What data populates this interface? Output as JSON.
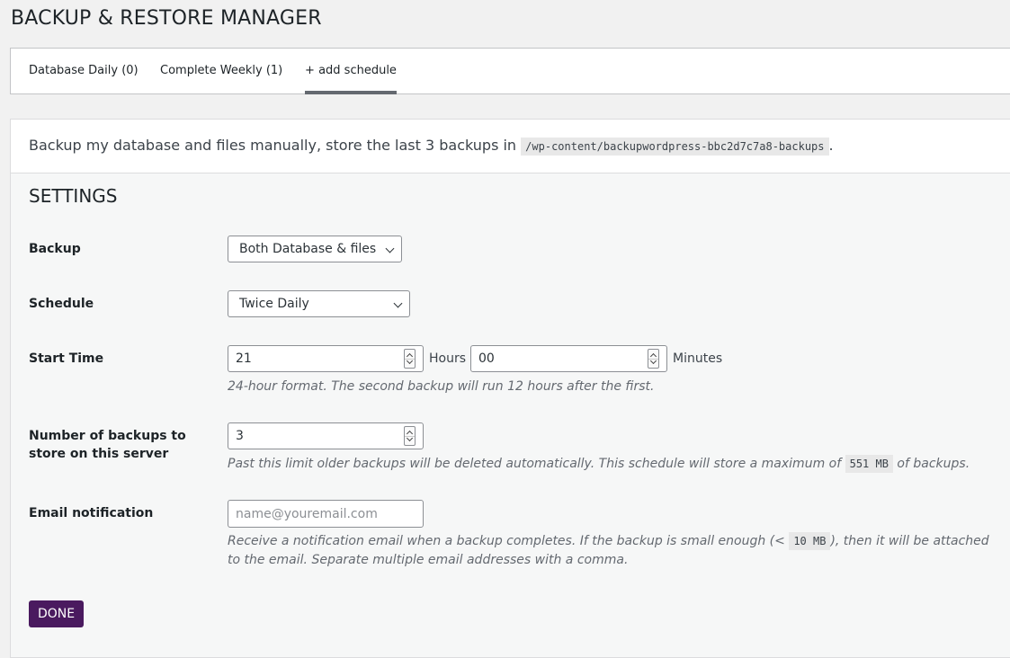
{
  "page": {
    "title": "BACKUP & RESTORE MANAGER"
  },
  "tabs": [
    {
      "label": "Database Daily (0)"
    },
    {
      "label": "Complete Weekly (1)"
    },
    {
      "label": "+ add schedule"
    }
  ],
  "intro": {
    "text": "Backup my database and files manually, store the last 3 backups in",
    "path": "/wp-content/backupwordpress-bbc2d7c7a8-backups",
    "suffix": "."
  },
  "settings": {
    "heading": "SETTINGS",
    "backup": {
      "label": "Backup",
      "value": "Both Database & files"
    },
    "schedule": {
      "label": "Schedule",
      "value": "Twice Daily"
    },
    "start_time": {
      "label": "Start Time",
      "hours": "21",
      "hours_unit": "Hours",
      "minutes": "00",
      "minutes_unit": "Minutes",
      "help": "24-hour format. The second backup will run 12 hours after the first."
    },
    "number_of_backups": {
      "label_line1": "Number of backups to",
      "label_line2": "store on this server",
      "value": "3",
      "help_before": "Past this limit older backups will be deleted automatically. This schedule will store a maximum of",
      "max_size": "551 MB",
      "help_after": "of backups."
    },
    "email": {
      "label": "Email notification",
      "placeholder": "name@youremail.com",
      "help_before": "Receive a notification email when a backup completes. If the backup is small enough (<",
      "limit": "10 MB",
      "help_after": "), then it will be attached",
      "help_line2": "to the email. Separate multiple email addresses with a comma."
    },
    "done_label": "DONE"
  },
  "colors": {
    "accent": "#4a1a5f",
    "tab_underline": "#646970"
  }
}
